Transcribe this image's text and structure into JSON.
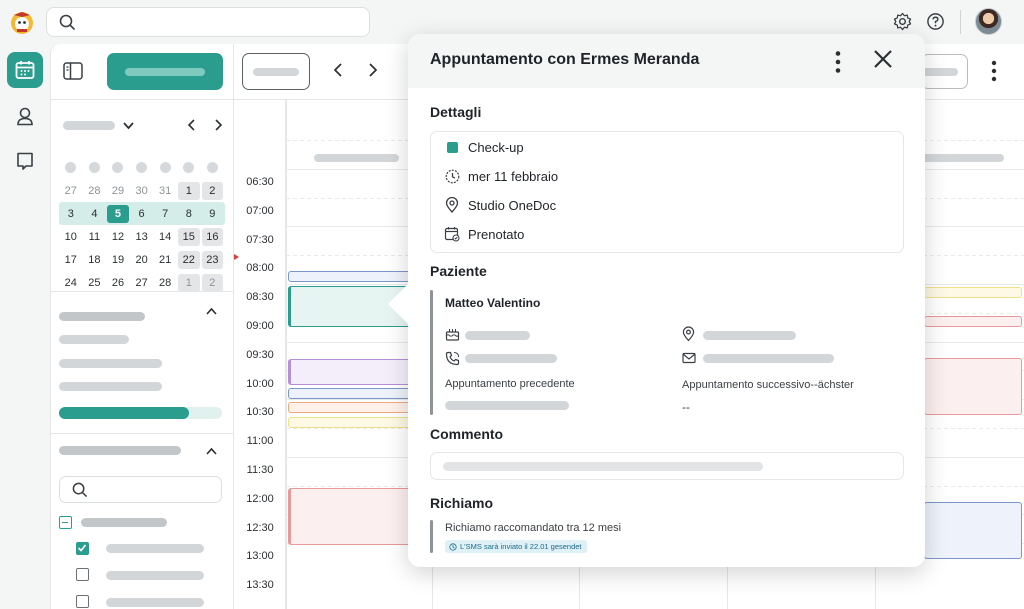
{
  "popover": {
    "title": "Appuntamento con Ermes Meranda",
    "details_heading": "Dettagli",
    "details": {
      "type": "Check-up",
      "date": "mer 11 febbraio",
      "location": "Studio OneDoc",
      "status": "Prenotato"
    },
    "patient_heading": "Paziente",
    "patient_name": "Matteo Valentino",
    "previous_appt_label": "Appuntamento precedente",
    "next_appt_label": "Appuntamento successivo--ächster",
    "next_appt_value": "--",
    "comment_heading": "Commento",
    "recall_heading": "Richiamo",
    "recall_text": "Richiamo raccomandato tra 12 mesi",
    "recall_badge": "L'SMS sarà inviato il 22.01 gesendet"
  },
  "mini_calendar": {
    "weeks": [
      [
        "27",
        "28",
        "29",
        "30",
        "31",
        "1",
        "2"
      ],
      [
        "3",
        "4",
        "5",
        "6",
        "7",
        "8",
        "9"
      ],
      [
        "10",
        "11",
        "12",
        "13",
        "14",
        "15",
        "16"
      ],
      [
        "17",
        "18",
        "19",
        "20",
        "21",
        "22",
        "23"
      ],
      [
        "24",
        "25",
        "26",
        "27",
        "28",
        "1",
        "2"
      ]
    ],
    "today": "5"
  },
  "times": [
    "06:30",
    "07:00",
    "07:30",
    "08:00",
    "08:30",
    "09:00",
    "09:30",
    "10:00",
    "10:30",
    "11:00",
    "11:30",
    "12:00",
    "12:30",
    "13:00",
    "13:30"
  ],
  "filters": {
    "progress_fraction": 0.8
  },
  "colors": {
    "brand": "#2a9d8f",
    "event_blue": "#7b96c8",
    "event_purple": "#b48fd6",
    "event_orange": "#f0a97a",
    "event_yellow": "#f1e08a",
    "event_red": "#e89a9a"
  }
}
